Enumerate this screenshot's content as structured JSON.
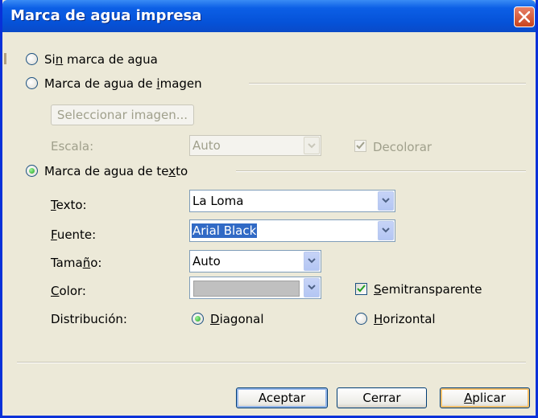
{
  "window": {
    "title": "Marca de agua impresa"
  },
  "options": {
    "no_watermark": {
      "label_pre": "Si",
      "label_key": "n",
      "label_post": " marca de agua",
      "checked": false
    },
    "picture_watermark": {
      "label_pre": "Marca de agua de ",
      "label_key": "i",
      "label_post": "magen",
      "checked": false
    },
    "text_watermark": {
      "label_pre": "Marca de agua de te",
      "label_key": "x",
      "label_post": "to",
      "checked": true
    }
  },
  "picture": {
    "select_button": "Seleccionar imagen...",
    "scale_label": "Escala:",
    "scale_value": "Auto",
    "washout_label": "Decolorar",
    "washout_checked": true
  },
  "text": {
    "text_label_key": "T",
    "text_label_post": "exto:",
    "text_value": "La Loma",
    "font_label_key": "F",
    "font_label_post": "uente:",
    "font_value": "Arial Black",
    "size_label_pre": "Tama",
    "size_label_key": "ñ",
    "size_label_post": "o:",
    "size_value": "Auto",
    "color_label_key": "C",
    "color_label_post": "olor:",
    "color_value": "#c0c0c0",
    "semitransparent_label_key": "S",
    "semitransparent_label_post": "emitransparente",
    "semitransparent_checked": true,
    "layout_label": "Distribución:",
    "diagonal_label_key": "D",
    "diagonal_label_post": "iagonal",
    "diagonal_checked": true,
    "horizontal_label_key": "H",
    "horizontal_label_post": "orizontal",
    "horizontal_checked": false
  },
  "buttons": {
    "ok": "Aceptar",
    "close": "Cerrar",
    "apply_key": "A",
    "apply_post": "plicar"
  },
  "colors": {
    "title_bar": "#0552d8",
    "dialog_bg": "#ece9d8",
    "selection": "#316ac5",
    "close_button": "#c8441c"
  }
}
